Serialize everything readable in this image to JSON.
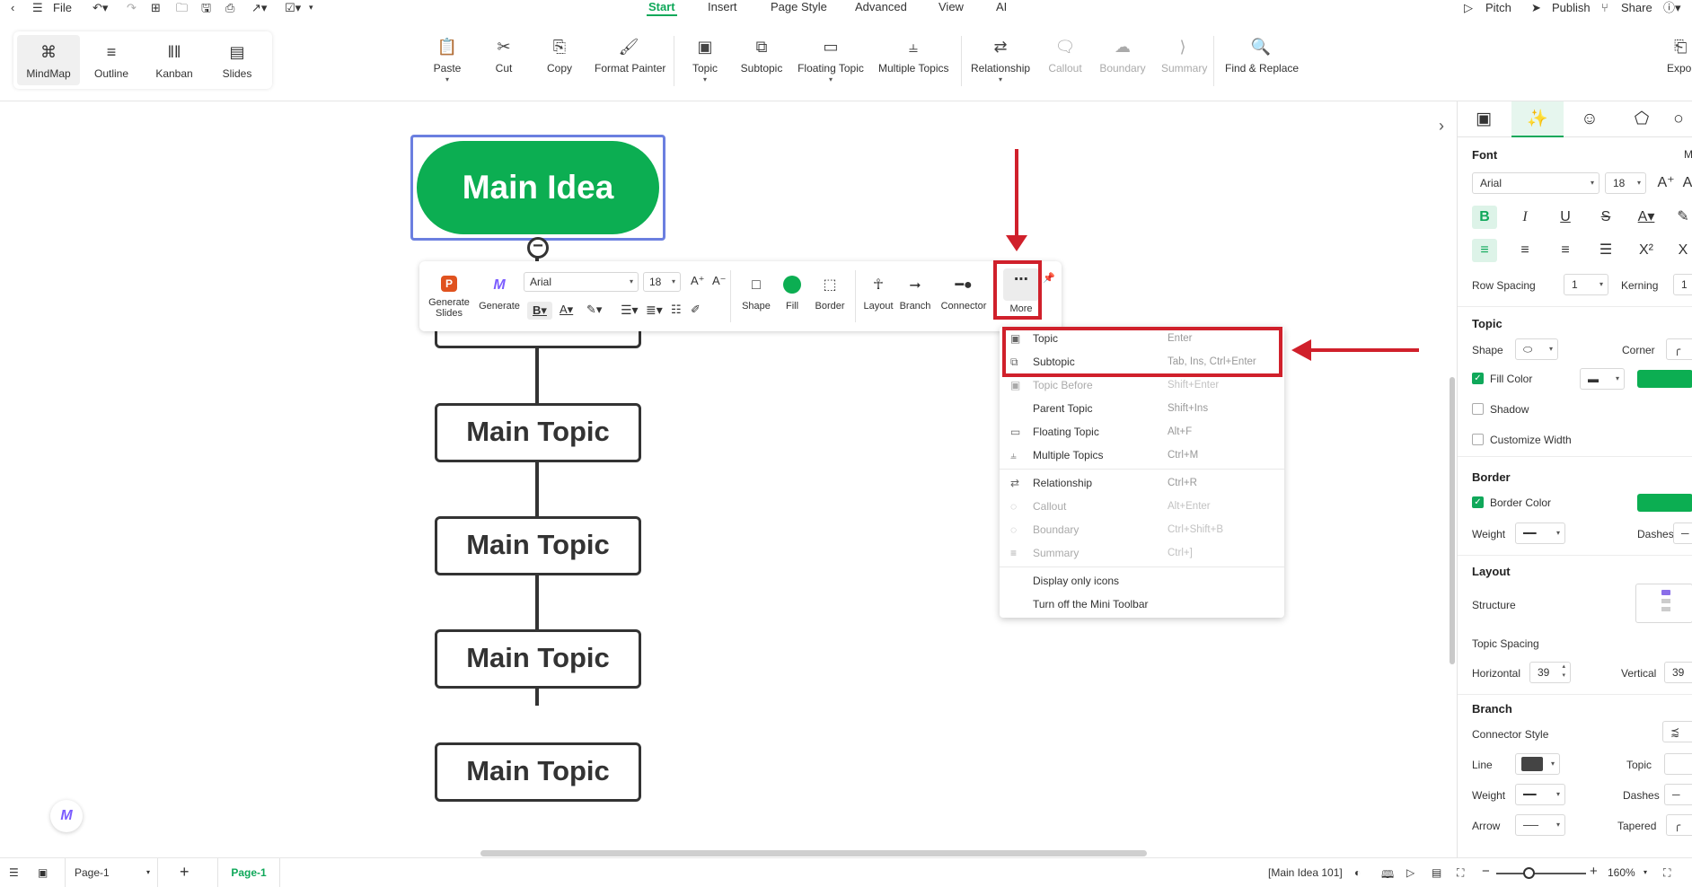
{
  "topbar": {
    "file_label": "File",
    "tabs": [
      "Start",
      "Insert",
      "Page Style",
      "Advanced",
      "View",
      "AI"
    ],
    "pitch_label": "Pitch",
    "publish_label": "Publish",
    "share_label": "Share"
  },
  "views": [
    "MindMap",
    "Outline",
    "Kanban",
    "Slides"
  ],
  "ribbon": {
    "paste": "Paste",
    "cut": "Cut",
    "copy": "Copy",
    "format_painter": "Format Painter",
    "topic": "Topic",
    "subtopic": "Subtopic",
    "floating_topic": "Floating Topic",
    "multiple_topics": "Multiple Topics",
    "relationship": "Relationship",
    "callout": "Callout",
    "boundary": "Boundary",
    "summary": "Summary",
    "find_replace": "Find & Replace",
    "expo": "Expo"
  },
  "canvas": {
    "main_idea": "Main Idea",
    "topics": [
      "Main Topic",
      "Main Topic",
      "Main Topic",
      "Main Topic"
    ]
  },
  "minitoolbar": {
    "generate_slides": "Generate Slides",
    "generate": "Generate",
    "font": "Arial",
    "font_size": "18",
    "shape": "Shape",
    "fill": "Fill",
    "border": "Border",
    "layout": "Layout",
    "branch": "Branch",
    "connector": "Connector",
    "more": "More"
  },
  "menu": {
    "items": [
      {
        "label": "Topic",
        "shortcut": "Enter",
        "disabled": false
      },
      {
        "label": "Subtopic",
        "shortcut": "Tab, Ins, Ctrl+Enter",
        "disabled": false
      },
      {
        "label": "Topic Before",
        "shortcut": "Shift+Enter",
        "disabled": true
      },
      {
        "label": "Parent Topic",
        "shortcut": "Shift+Ins",
        "disabled": false
      },
      {
        "label": "Floating Topic",
        "shortcut": "Alt+F",
        "disabled": false
      },
      {
        "label": "Multiple Topics",
        "shortcut": "Ctrl+M",
        "disabled": false
      },
      {
        "label": "Relationship",
        "shortcut": "Ctrl+R",
        "disabled": false
      },
      {
        "label": "Callout",
        "shortcut": "Alt+Enter",
        "disabled": true
      },
      {
        "label": "Boundary",
        "shortcut": "Ctrl+Shift+B",
        "disabled": true
      },
      {
        "label": "Summary",
        "shortcut": "Ctrl+]",
        "disabled": true
      },
      {
        "label": "Display only icons",
        "shortcut": "",
        "disabled": false
      },
      {
        "label": "Turn off the Mini Toolbar",
        "shortcut": "",
        "disabled": false
      }
    ]
  },
  "panel": {
    "font_heading": "Font",
    "font_extra": "M",
    "font_name": "Arial",
    "font_size": "18",
    "row_spacing_label": "Row Spacing",
    "row_spacing_value": "1",
    "kerning_label": "Kerning",
    "kerning_value": "1",
    "topic_heading": "Topic",
    "shape_label": "Shape",
    "corner_label": "Corner",
    "fill_color_label": "Fill Color",
    "shadow_label": "Shadow",
    "customize_width_label": "Customize Width",
    "border_heading": "Border",
    "border_color_label": "Border Color",
    "weight_label": "Weight",
    "dashes_label": "Dashes",
    "layout_heading": "Layout",
    "structure_label": "Structure",
    "topic_spacing_label": "Topic Spacing",
    "horizontal_label": "Horizontal",
    "horizontal_value": "39",
    "vertical_label": "Vertical",
    "vertical_value": "39",
    "branch_heading": "Branch",
    "connector_style_label": "Connector Style",
    "line_label": "Line",
    "topic_label": "Topic",
    "branch_weight_label": "Weight",
    "branch_dashes_label": "Dashes",
    "arrow_label": "Arrow",
    "tapered_label": "Tapered"
  },
  "status": {
    "page_select": "Page-1",
    "page_tab": "Page-1",
    "selection_info": "[Main Idea 101]",
    "zoom": "160%"
  },
  "colors": {
    "accent": "#10a85a",
    "main_idea_fill": "#0cae52",
    "highlight": "#d0202b"
  }
}
